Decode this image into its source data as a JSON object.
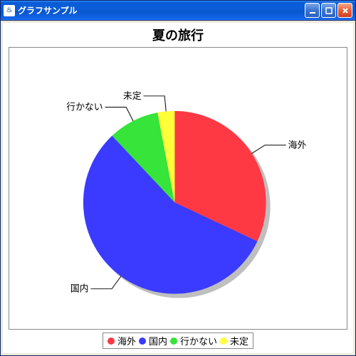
{
  "window": {
    "title": "グラフサンプル"
  },
  "chart_data": {
    "type": "pie",
    "title": "夏の旅行",
    "series": [
      {
        "name": "海外",
        "value": 32,
        "color": "#ff3944"
      },
      {
        "name": "国内",
        "value": 56,
        "color": "#3a3bff"
      },
      {
        "name": "行かない",
        "value": 9,
        "color": "#36e43a"
      },
      {
        "name": "未定",
        "value": 3,
        "color": "#ffff3a"
      }
    ],
    "legend_position": "bottom"
  }
}
